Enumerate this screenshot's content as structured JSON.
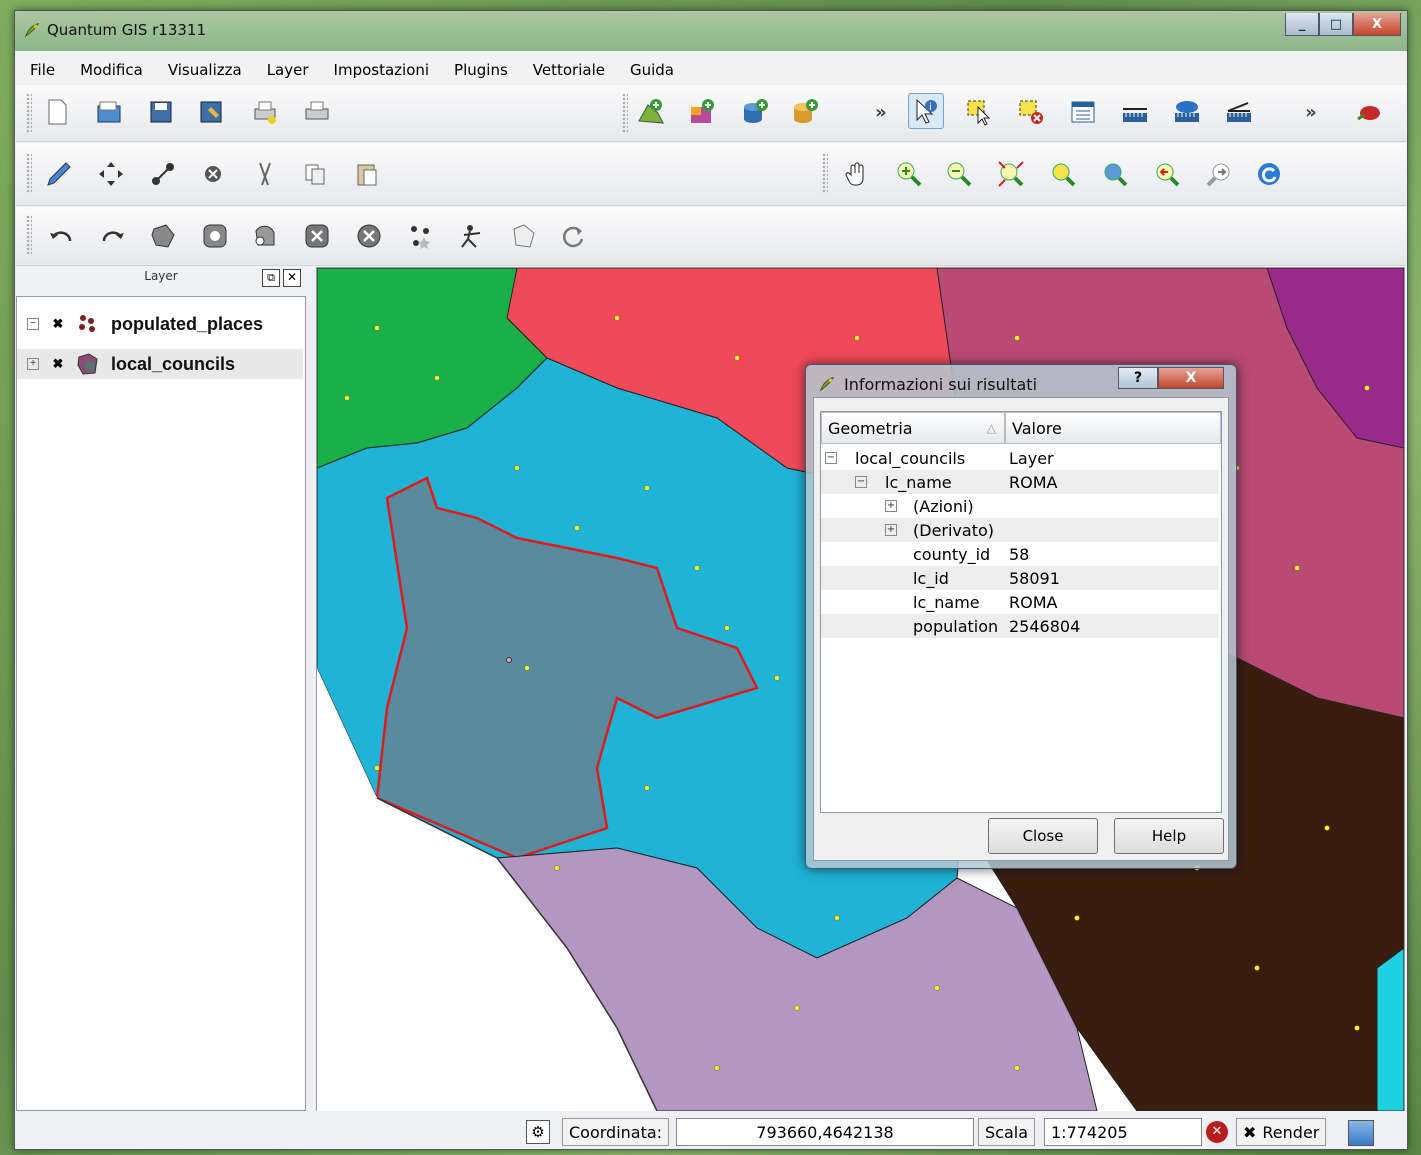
{
  "window": {
    "title": "Quantum GIS r13311",
    "min_label": "_",
    "max_label": "□",
    "close_label": "X"
  },
  "menu": [
    "File",
    "Modifica",
    "Visualizza",
    "Layer",
    "Impostazioni",
    "Plugins",
    "Vettoriale",
    "Guida"
  ],
  "toolbar": {
    "overflow_1": "»",
    "overflow_2": "»"
  },
  "layers_panel": {
    "title": "Layer",
    "items": [
      {
        "name": "populated_places",
        "expand": "−",
        "checked": "✖"
      },
      {
        "name": "local_councils",
        "expand": "+",
        "checked": "✖"
      }
    ]
  },
  "dialog": {
    "title": "Informazioni sui risultati",
    "help_icon": "?",
    "close_icon": "X",
    "columns": [
      "Geometria",
      "Valore"
    ],
    "rows": [
      {
        "key": "local_councils",
        "value": "Layer",
        "expand": "−"
      },
      {
        "key": "lc_name",
        "value": "ROMA",
        "expand": "−"
      },
      {
        "key": "(Azioni)",
        "value": "",
        "expand": "+"
      },
      {
        "key": "(Derivato)",
        "value": "",
        "expand": "+"
      },
      {
        "key": "county_id",
        "value": "58",
        "expand": ""
      },
      {
        "key": "lc_id",
        "value": "58091",
        "expand": ""
      },
      {
        "key": "lc_name",
        "value": "ROMA",
        "expand": ""
      },
      {
        "key": "population",
        "value": "2546804",
        "expand": ""
      }
    ],
    "close_button": "Close",
    "help_button": "Help"
  },
  "status": {
    "coord_label": "Coordinata:",
    "coord_value": "793660,4642138",
    "scale_label": "Scala",
    "scale_value": "1:774205",
    "render_check": "✖",
    "render_label": "Render"
  }
}
